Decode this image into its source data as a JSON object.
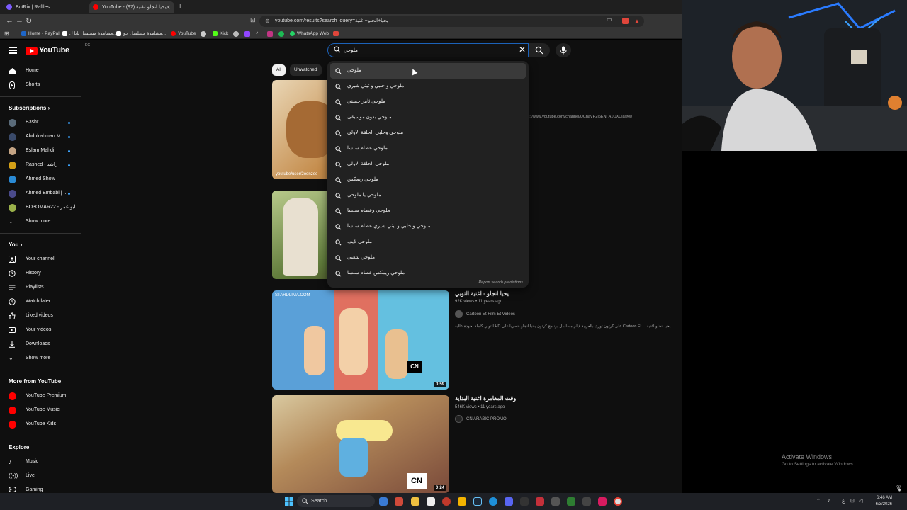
{
  "browser": {
    "tabs": [
      {
        "title": "BotRix | Raffles",
        "color": "#7c5cff"
      },
      {
        "title": "YouTube - (97) يحيا انجلو اغنية",
        "color": "#ff0000"
      }
    ],
    "url": "youtube.com/results?search_query=يحيا+انجلو+اغنية",
    "bookmarks": [
      {
        "label": "Home - PayPal",
        "color": "#1e66c8"
      },
      {
        "label": "مشاهدة مسلسل بابا ل...",
        "color": "#ffffff"
      },
      {
        "label": "مشاهدة مسلسل جو...",
        "color": "#ffffff"
      },
      {
        "label": "YouTube",
        "color": "#ff0000"
      },
      {
        "label": "Kick",
        "color": "#53fc18"
      },
      {
        "label": "WhatsApp Web",
        "color": "#25d366"
      }
    ]
  },
  "youtube": {
    "logo_text": "YouTube",
    "country_code": "EG",
    "search_value": "ملوحي",
    "chips": [
      "All",
      "Unwatched"
    ],
    "sidebar": {
      "main": [
        {
          "label": "Home",
          "icon": "home-icon"
        },
        {
          "label": "Shorts",
          "icon": "shorts-icon"
        }
      ],
      "subscriptions_heading": "Subscriptions",
      "subscriptions": [
        {
          "label": "B3shr",
          "color": "#5a6b7a"
        },
        {
          "label": "Abdulrahman M...",
          "color": "#3a4a6a"
        },
        {
          "label": "Eslam Mahdi",
          "color": "#c4a484"
        },
        {
          "label": "Rashed - راشد",
          "color": "#d4a017"
        },
        {
          "label": "Ahmed Show",
          "color": "#2a8ad4"
        },
        {
          "label": "Ahmed Embabi | ...",
          "color": "#4a4a8a"
        },
        {
          "label": "BO3OMAR22 - ابو عمر",
          "color": "#9ab04a"
        }
      ],
      "show_more": "Show more",
      "you_heading": "You",
      "you": [
        {
          "label": "Your channel",
          "icon": "channel-icon"
        },
        {
          "label": "History",
          "icon": "history-icon"
        },
        {
          "label": "Playlists",
          "icon": "playlists-icon"
        },
        {
          "label": "Watch later",
          "icon": "watch-later-icon"
        },
        {
          "label": "Liked videos",
          "icon": "like-icon"
        },
        {
          "label": "Your videos",
          "icon": "your-videos-icon"
        },
        {
          "label": "Downloads",
          "icon": "download-icon"
        }
      ],
      "show_more_2": "Show more",
      "more_heading": "More from YouTube",
      "more": [
        {
          "label": "YouTube Premium"
        },
        {
          "label": "YouTube Music"
        },
        {
          "label": "YouTube Kids"
        }
      ],
      "explore_heading": "Explore",
      "explore": [
        {
          "label": "Music",
          "icon": "music-icon"
        },
        {
          "label": "Live",
          "icon": "live-icon"
        },
        {
          "label": "Gaming",
          "icon": "gaming-icon"
        }
      ]
    },
    "suggestions": [
      "ملوحي",
      "ملوحي و حلبي و ثيثي شيري",
      "ملوحي ثامر حسني",
      "ملوحي بدون موسيقى",
      "ملوحي وحلبي الحلقة الاولى",
      "ملوحي عصام سلسا",
      "ملوحي الحلقة الاولى",
      "ملوحي ريمكس",
      "ملوحي يا ملوحي",
      "ملوحي وعصام سلسا",
      "ملوحي و حلبي و ثيثي شيري عصام سلسا",
      "ملوحي لايف",
      "ملوحي شعبي",
      "ملوحي ريمكس عصام سلسا"
    ],
    "report_label": "Report search predictions",
    "results": {
      "r1_thumb_caption": "youtube/user/2oonzee",
      "r1_desc_link": "...s://www.youtube.com/channel/UCnaVP2I6EN_A1QXCiajtKw",
      "r3": {
        "title": "يحيا انجلو - اغنية التوبي",
        "views": "92K views • 11 years ago",
        "channel": "Cartoon Et Film Et Videos",
        "desc": "التوبي كاملة بجودة عالية HD على كرتون تورك بالعربية فيلم مسلسل برنامج كرتون يحيا انجلو حصريا على Cartoon Et ... يحيا انجلو اغنية",
        "thumb_text": "STARDLIMA.COM",
        "duration": "0:59"
      },
      "r4": {
        "title": "وقت المغامرة اغنية البداية",
        "views": "546K views • 11 years ago",
        "channel": "CN ARABIC PROMO",
        "duration": "0:24"
      }
    }
  },
  "desktop": {
    "activate_title": "Activate Windows",
    "activate_sub": "Go to Settings to activate Windows."
  },
  "taskbar": {
    "search_label": "Search",
    "time": "6:46 AM",
    "date": "6/3/2026"
  }
}
